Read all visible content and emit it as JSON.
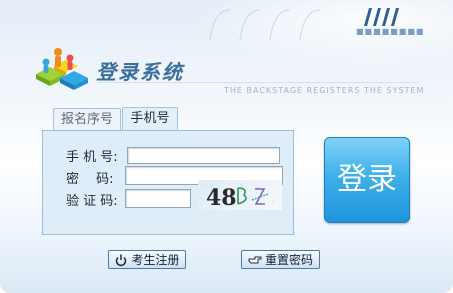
{
  "header": {
    "title": "登录系统",
    "subtitle": "THE BACKSTAGE REGISTERS THE SYSTEM",
    "deco_dots": "■■■■■■■■"
  },
  "tabs": [
    {
      "label": "报名序号",
      "active": false
    },
    {
      "label": "手机号",
      "active": true
    }
  ],
  "form": {
    "phone_label": "手 机 号:",
    "password_label": "密　 码:",
    "captcha_label": "验 证 码:",
    "phone_value": "",
    "password_value": "",
    "captcha_value": "",
    "captcha_text": "48"
  },
  "buttons": {
    "login": "登录",
    "register": "考生注册",
    "reset_password": "重置密码"
  },
  "colors": {
    "accent": "#3fb0ea",
    "title": "#3a6e9c"
  },
  "icons": {
    "register": "power-icon",
    "reset_password": "hand-pointer-icon"
  }
}
